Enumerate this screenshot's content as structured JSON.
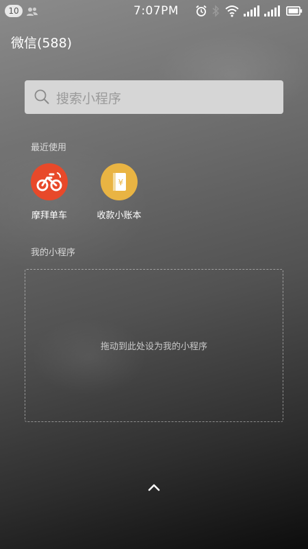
{
  "status_bar": {
    "notification_count": "10",
    "time": "7:07PM"
  },
  "header": {
    "title": "微信(588)"
  },
  "search": {
    "placeholder": "搜索小程序"
  },
  "recent": {
    "label": "最近使用",
    "items": [
      {
        "name": "摩拜单车",
        "icon": "bicycle-icon",
        "color": "#e8492a"
      },
      {
        "name": "收款小账本",
        "icon": "ledger-icon",
        "color": "#e9b443"
      }
    ]
  },
  "mine": {
    "label": "我的小程序",
    "drop_hint": "拖动到此处设为我的小程序"
  },
  "footer": {
    "icon": "chevron-up-icon"
  }
}
